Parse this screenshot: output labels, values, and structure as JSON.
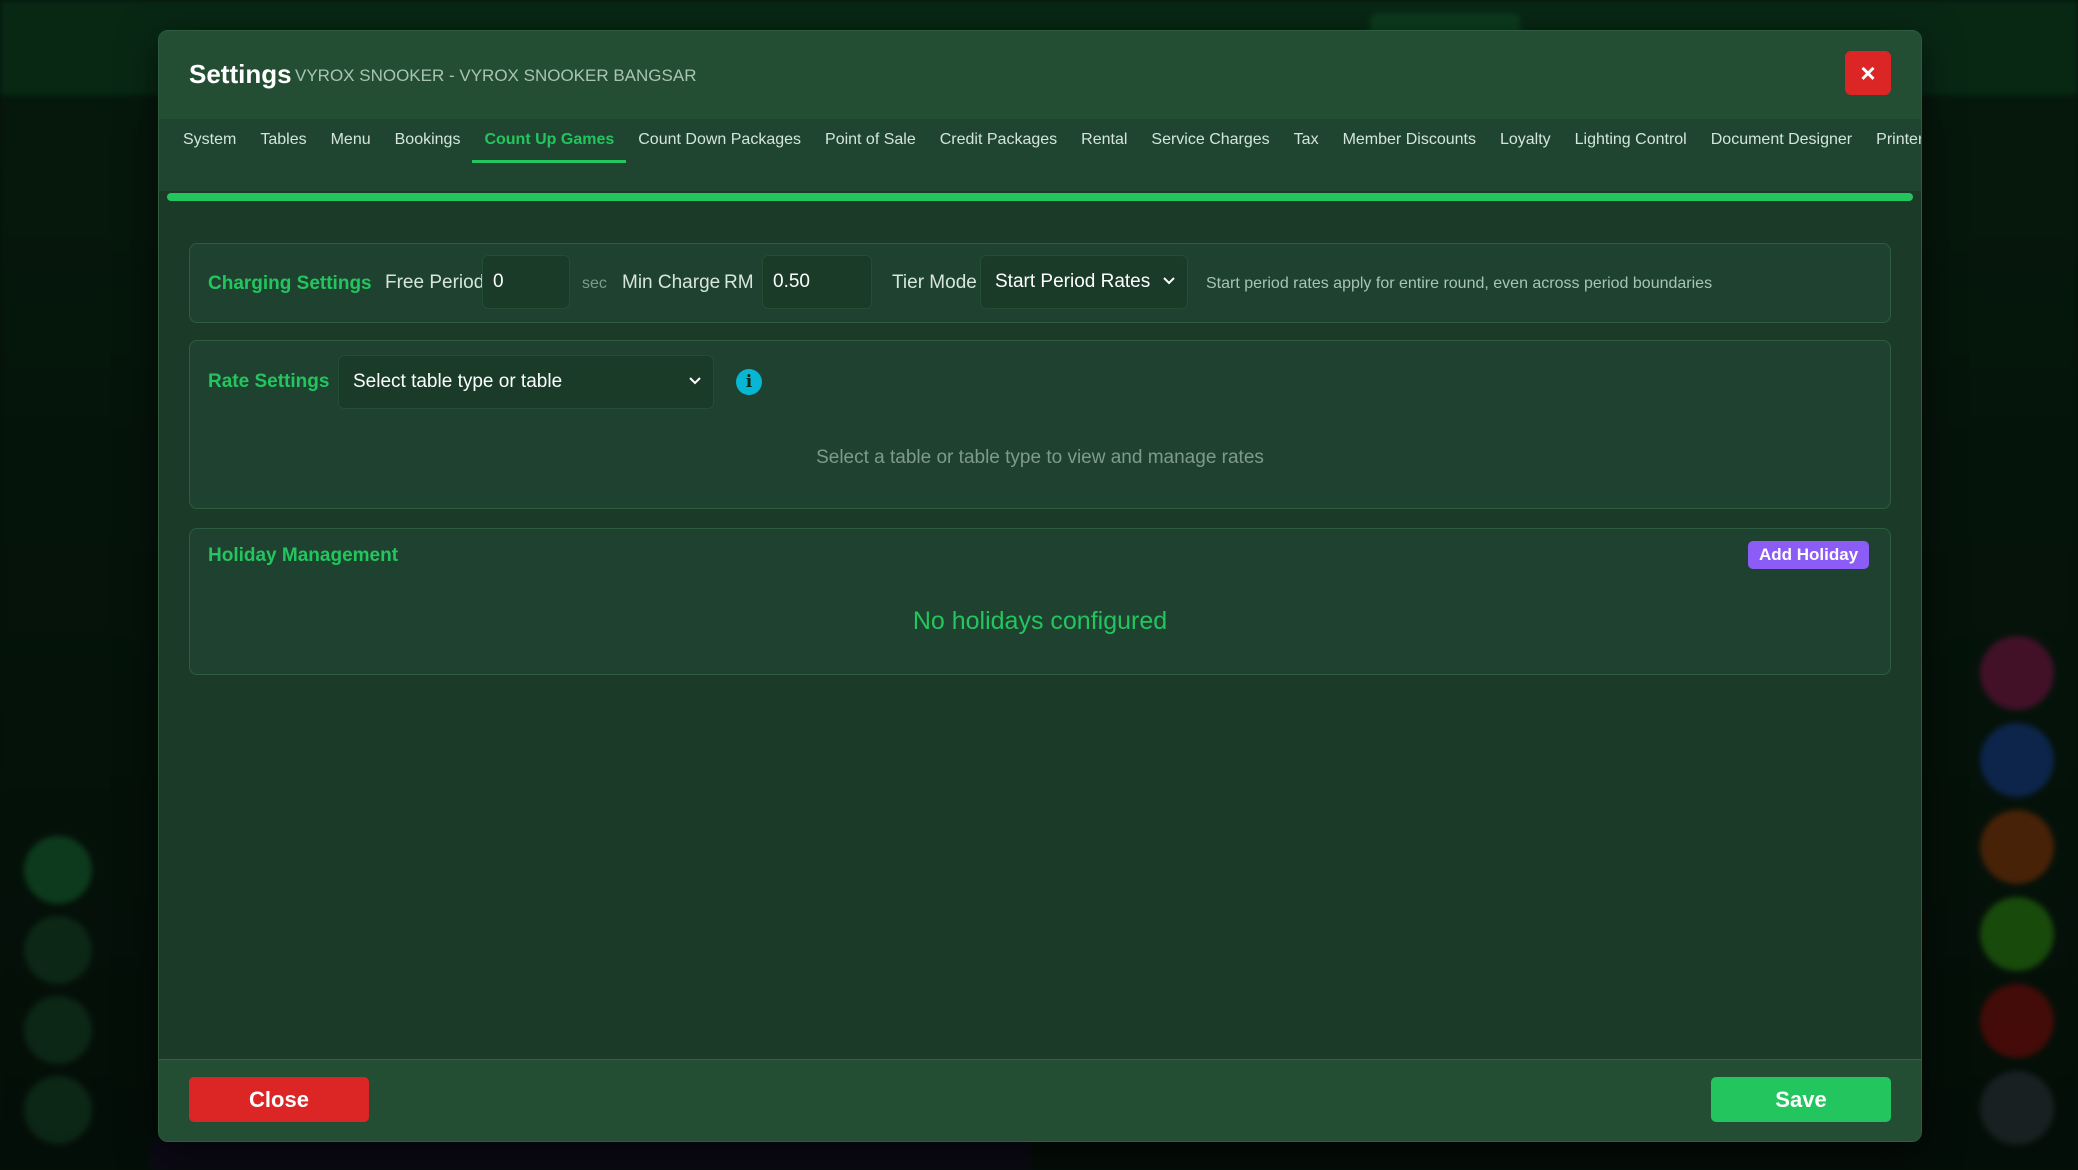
{
  "modal": {
    "title": "Settings",
    "subtitle": "VYROX SNOOKER - VYROX SNOOKER BANGSAR",
    "close_x": "×"
  },
  "tabs": [
    {
      "label": "System",
      "active": false
    },
    {
      "label": "Tables",
      "active": false
    },
    {
      "label": "Menu",
      "active": false
    },
    {
      "label": "Bookings",
      "active": false
    },
    {
      "label": "Count Up Games",
      "active": true
    },
    {
      "label": "Count Down Packages",
      "active": false
    },
    {
      "label": "Point of Sale",
      "active": false
    },
    {
      "label": "Credit Packages",
      "active": false
    },
    {
      "label": "Rental",
      "active": false
    },
    {
      "label": "Service Charges",
      "active": false
    },
    {
      "label": "Tax",
      "active": false
    },
    {
      "label": "Member Discounts",
      "active": false
    },
    {
      "label": "Loyalty",
      "active": false
    },
    {
      "label": "Lighting Control",
      "active": false
    },
    {
      "label": "Document Designer",
      "active": false
    },
    {
      "label": "Printers",
      "active": false
    }
  ],
  "charging": {
    "label": "Charging Settings",
    "free_period_label": "Free Period",
    "free_period_value": "0",
    "free_period_unit": "sec",
    "min_charge_label": "Min Charge",
    "min_charge_currency": "RM",
    "min_charge_value": "0.50",
    "tier_mode_label": "Tier Mode",
    "tier_mode_value": "Start Period Rates",
    "tier_mode_hint": "Start period rates apply for entire round, even across period boundaries"
  },
  "rates": {
    "label": "Rate Settings",
    "select_value": "Select table type or table",
    "info_icon": "i",
    "empty_message": "Select a table or table type to view and manage rates"
  },
  "holidays": {
    "label": "Holiday Management",
    "add_button": "Add Holiday",
    "empty_message": "No holidays configured"
  },
  "footer": {
    "close_label": "Close",
    "save_label": "Save"
  },
  "colors": {
    "accent": "#22c55e",
    "danger": "#dc2626",
    "purple": "#8b5cf6",
    "info": "#06b6d4"
  }
}
